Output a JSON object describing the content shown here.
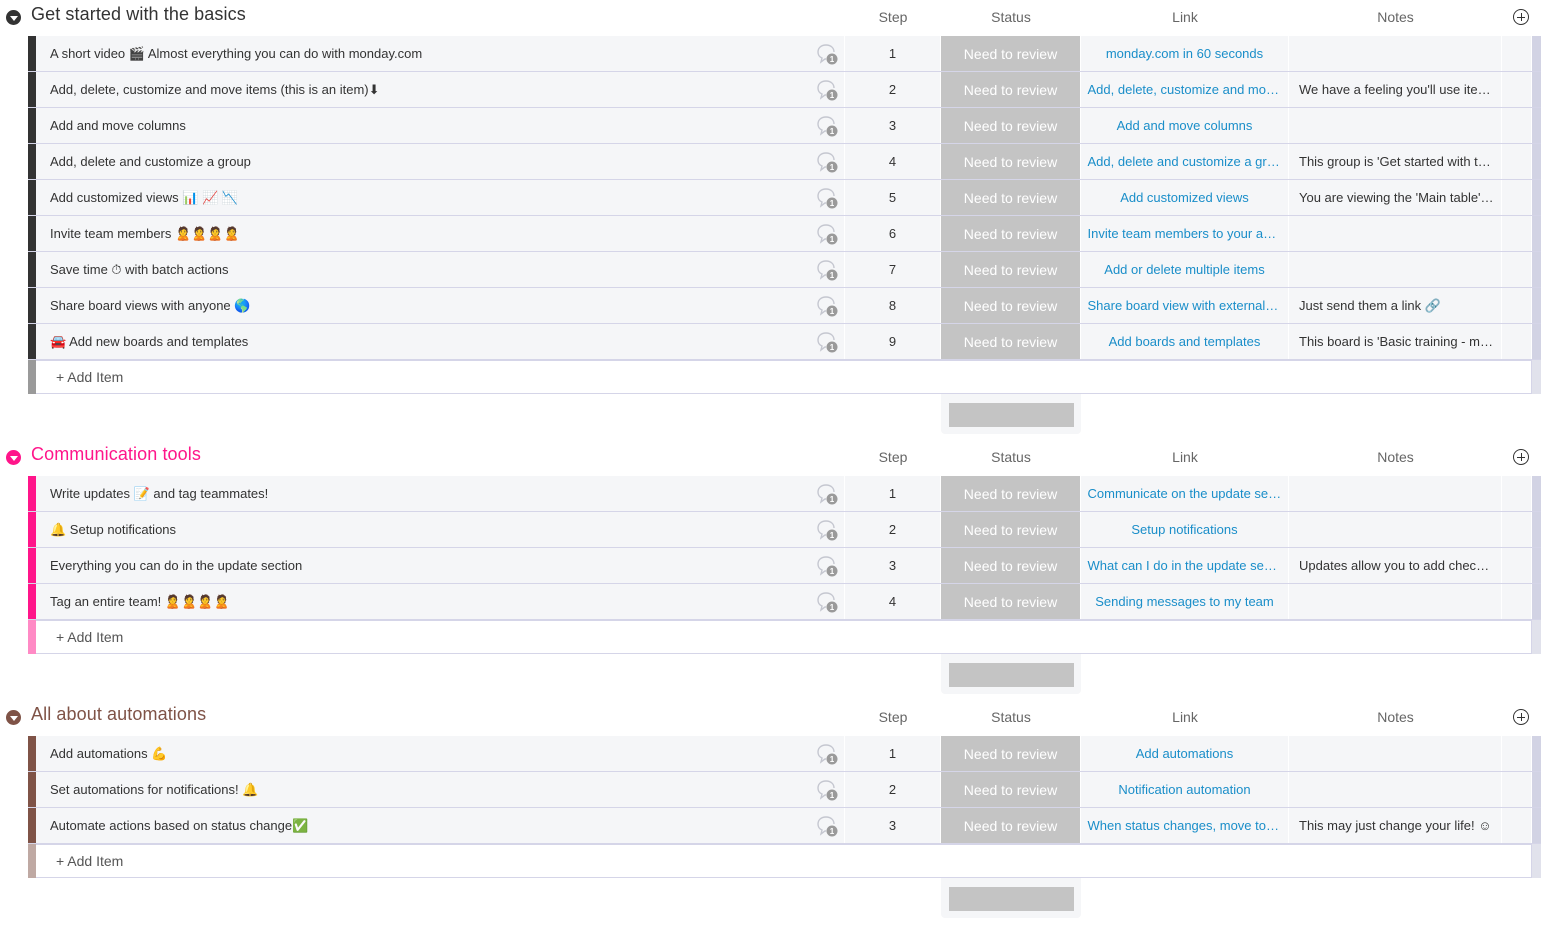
{
  "columns": {
    "step": "Step",
    "status": "Status",
    "link": "Link",
    "notes": "Notes"
  },
  "add_item_label": "+ Add Item",
  "groups": [
    {
      "title": "Get started with the basics",
      "color": "#333333",
      "edge_color": "#333333",
      "add_edge_color": "#9a9a9a",
      "items": [
        {
          "name": "A short video 🎬 Almost everything you can do with monday.com",
          "updates": "1",
          "step": "1",
          "status": "Need to review",
          "link": "monday.com in 60 seconds",
          "notes": ""
        },
        {
          "name": "Add, delete, customize and move items (this is an item)⬇",
          "updates": "1",
          "step": "2",
          "status": "Need to review",
          "link": "Add, delete, customize and move items",
          "notes": "We have a feeling you'll use items a lot"
        },
        {
          "name": "Add and move columns",
          "updates": "1",
          "step": "3",
          "status": "Need to review",
          "link": "Add and move columns",
          "notes": ""
        },
        {
          "name": "Add, delete and customize a group",
          "updates": "1",
          "step": "4",
          "status": "Need to review",
          "link": "Add, delete and customize a group",
          "notes": "This group is 'Get started with the basics'"
        },
        {
          "name": "Add customized views 📊 📈 📉",
          "updates": "1",
          "step": "5",
          "status": "Need to review",
          "link": "Add customized views",
          "notes": "You are viewing the 'Main table' view"
        },
        {
          "name": "Invite team members 🙎🙎🙎🙎",
          "updates": "1",
          "step": "6",
          "status": "Need to review",
          "link": "Invite team members to your account",
          "notes": ""
        },
        {
          "name": "Save time ⏱ with batch actions",
          "updates": "1",
          "step": "7",
          "status": "Need to review",
          "link": "Add or delete multiple items",
          "notes": ""
        },
        {
          "name": "Share board views with anyone 🌎",
          "updates": "1",
          "step": "8",
          "status": "Need to review",
          "link": "Share board view with external users",
          "notes": "Just send them a link 🔗"
        },
        {
          "name": "🚘 Add new boards and templates",
          "updates": "1",
          "step": "9",
          "status": "Need to review",
          "link": "Add boards and templates",
          "notes": "This board is 'Basic training - monday.com'"
        }
      ]
    },
    {
      "title": "Communication tools",
      "color": "#ff158a",
      "edge_color": "#ff158a",
      "add_edge_color": "#ff8ac5",
      "items": [
        {
          "name": "Write updates 📝 and tag teammates!",
          "updates": "1",
          "step": "1",
          "status": "Need to review",
          "link": "Communicate on the update section",
          "notes": ""
        },
        {
          "name": "🔔 Setup notifications",
          "updates": "1",
          "step": "2",
          "status": "Need to review",
          "link": "Setup notifications",
          "notes": ""
        },
        {
          "name": "Everything you can do in the update section",
          "updates": "1",
          "step": "3",
          "status": "Need to review",
          "link": "What can I do in the update section",
          "notes": "Updates allow you to add checklists"
        },
        {
          "name": "Tag an entire team! 🙎🙎🙎🙎",
          "updates": "1",
          "step": "4",
          "status": "Need to review",
          "link": "Sending messages to my team",
          "notes": ""
        }
      ]
    },
    {
      "title": "All about automations",
      "color": "#7f5347",
      "edge_color": "#7f5347",
      "add_edge_color": "#bfa9a3",
      "items": [
        {
          "name": "Add automations 💪",
          "updates": "1",
          "step": "1",
          "status": "Need to review",
          "link": "Add automations",
          "notes": ""
        },
        {
          "name": "Set automations for notifications! 🔔",
          "updates": "1",
          "step": "2",
          "status": "Need to review",
          "link": "Notification automation",
          "notes": ""
        },
        {
          "name": "Automate actions based on status change✅",
          "updates": "1",
          "step": "3",
          "status": "Need to review",
          "link": "When status changes, move to group",
          "notes": "This may just change your life! ☺"
        }
      ]
    }
  ]
}
